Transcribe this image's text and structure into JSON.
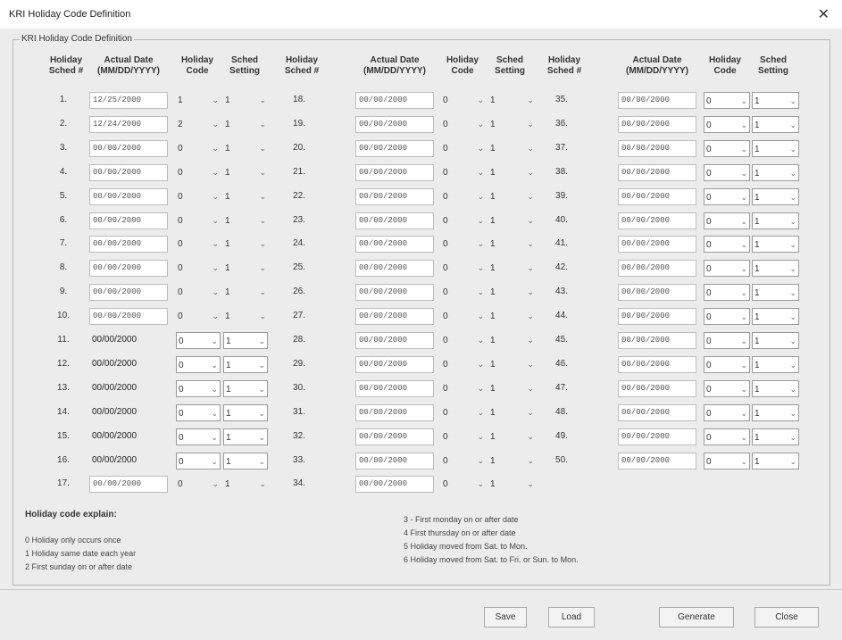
{
  "window": {
    "title": "KRI Holiday Code Definition",
    "close_glyph": "✕"
  },
  "group_title": "KRI Holiday Code Definition",
  "headers": {
    "sched": "Holiday\nSched #",
    "date": "Actual Date\n(MM/DD/YYYY)",
    "code": "Holiday\nCode",
    "setting": "Sched\nSetting"
  },
  "rows": [
    {
      "num": "1.",
      "date": "12/25/2000",
      "code": "1",
      "setting": "1"
    },
    {
      "num": "2.",
      "date": "12/24/2000",
      "code": "2",
      "setting": "1"
    },
    {
      "num": "3.",
      "date": "00/00/2000",
      "code": "0",
      "setting": "1"
    },
    {
      "num": "4.",
      "date": "00/00/2000",
      "code": "0",
      "setting": "1"
    },
    {
      "num": "5.",
      "date": "00/00/2000",
      "code": "0",
      "setting": "1"
    },
    {
      "num": "6.",
      "date": "00/00/2000",
      "code": "0",
      "setting": "1"
    },
    {
      "num": "7.",
      "date": "00/00/2000",
      "code": "0",
      "setting": "1"
    },
    {
      "num": "8.",
      "date": "00/00/2000",
      "code": "0",
      "setting": "1"
    },
    {
      "num": "9.",
      "date": "00/00/2000",
      "code": "0",
      "setting": "1"
    },
    {
      "num": "10.",
      "date": "00/00/2000",
      "code": "0",
      "setting": "1"
    },
    {
      "num": "11.",
      "date": "00/00/2000",
      "code": "0",
      "setting": "1"
    },
    {
      "num": "12.",
      "date": "00/00/2000",
      "code": "0",
      "setting": "1"
    },
    {
      "num": "13.",
      "date": "00/00/2000",
      "code": "0",
      "setting": "1"
    },
    {
      "num": "14.",
      "date": "00/00/2000",
      "code": "0",
      "setting": "1"
    },
    {
      "num": "15.",
      "date": "00/00/2000",
      "code": "0",
      "setting": "1"
    },
    {
      "num": "16.",
      "date": "00/00/2000",
      "code": "0",
      "setting": "1"
    },
    {
      "num": "17.",
      "date": "00/00/2000",
      "code": "0",
      "setting": "1"
    },
    {
      "num": "18.",
      "date": "00/00/2000",
      "code": "0",
      "setting": "1"
    },
    {
      "num": "19.",
      "date": "00/00/2000",
      "code": "0",
      "setting": "1"
    },
    {
      "num": "20.",
      "date": "00/00/2000",
      "code": "0",
      "setting": "1"
    },
    {
      "num": "21.",
      "date": "00/00/2000",
      "code": "0",
      "setting": "1"
    },
    {
      "num": "22.",
      "date": "00/00/2000",
      "code": "0",
      "setting": "1"
    },
    {
      "num": "23.",
      "date": "00/00/2000",
      "code": "0",
      "setting": "1"
    },
    {
      "num": "24.",
      "date": "00/00/2000",
      "code": "0",
      "setting": "1"
    },
    {
      "num": "25.",
      "date": "00/00/2000",
      "code": "0",
      "setting": "1"
    },
    {
      "num": "26.",
      "date": "00/00/2000",
      "code": "0",
      "setting": "1"
    },
    {
      "num": "27.",
      "date": "00/00/2000",
      "code": "0",
      "setting": "1"
    },
    {
      "num": "28.",
      "date": "00/00/2000",
      "code": "0",
      "setting": "1"
    },
    {
      "num": "29.",
      "date": "00/00/2000",
      "code": "0",
      "setting": "1"
    },
    {
      "num": "30.",
      "date": "00/00/2000",
      "code": "0",
      "setting": "1"
    },
    {
      "num": "31.",
      "date": "00/00/2000",
      "code": "0",
      "setting": "1"
    },
    {
      "num": "32.",
      "date": "00/00/2000",
      "code": "0",
      "setting": "1"
    },
    {
      "num": "33.",
      "date": "00/00/2000",
      "code": "0",
      "setting": "1"
    },
    {
      "num": "34.",
      "date": "00/00/2000",
      "code": "0",
      "setting": "1"
    },
    {
      "num": "35.",
      "date": "00/00/2000",
      "code": "0",
      "setting": "1"
    },
    {
      "num": "36.",
      "date": "00/00/2000",
      "code": "0",
      "setting": "1"
    },
    {
      "num": "37.",
      "date": "00/00/2000",
      "code": "0",
      "setting": "1"
    },
    {
      "num": "38.",
      "date": "00/00/2000",
      "code": "0",
      "setting": "1"
    },
    {
      "num": "39.",
      "date": "00/00/2000",
      "code": "0",
      "setting": "1"
    },
    {
      "num": "40.",
      "date": "00/00/2000",
      "code": "0",
      "setting": "1"
    },
    {
      "num": "41.",
      "date": "00/00/2000",
      "code": "0",
      "setting": "1"
    },
    {
      "num": "42.",
      "date": "00/00/2000",
      "code": "0",
      "setting": "1"
    },
    {
      "num": "43.",
      "date": "00/00/2000",
      "code": "0",
      "setting": "1"
    },
    {
      "num": "44.",
      "date": "00/00/2000",
      "code": "0",
      "setting": "1"
    },
    {
      "num": "45.",
      "date": "00/00/2000",
      "code": "0",
      "setting": "1"
    },
    {
      "num": "46.",
      "date": "00/00/2000",
      "code": "0",
      "setting": "1"
    },
    {
      "num": "47.",
      "date": "00/00/2000",
      "code": "0",
      "setting": "1"
    },
    {
      "num": "48.",
      "date": "00/00/2000",
      "code": "0",
      "setting": "1"
    },
    {
      "num": "49.",
      "date": "00/00/2000",
      "code": "0",
      "setting": "1"
    },
    {
      "num": "50.",
      "date": "00/00/2000",
      "code": "0",
      "setting": "1"
    }
  ],
  "explain": {
    "heading": "Holiday code explain:",
    "left": [
      "0  Holiday only occurs once",
      "1  Holiday same date each year",
      "2  First sunday on or after date"
    ],
    "right": [
      "3 - First monday on or after date",
      "4  First thursday on or after date",
      "5  Holiday moved from Sat. to Mon.",
      "6  Holiday moved from Sat. to Fri. or Sun. to Mon."
    ]
  },
  "buttons": {
    "save": "Save",
    "load": "Load",
    "generate": "Generate",
    "close": "Close"
  },
  "chevron": "⌄"
}
